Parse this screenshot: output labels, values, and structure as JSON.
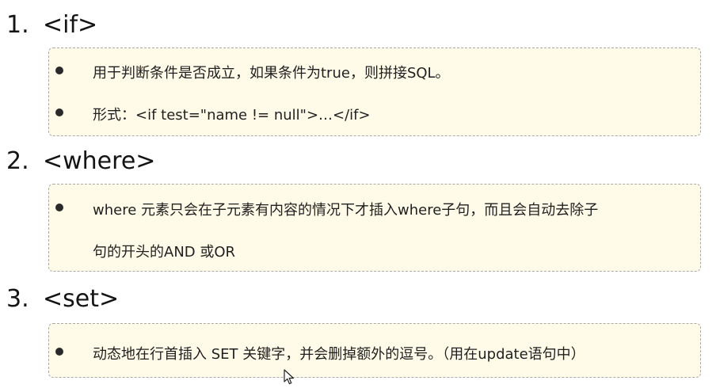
{
  "sections": [
    {
      "number": "1.",
      "title": "<if>",
      "items": [
        "用于判断条件是否成立，如果条件为true，则拼接SQL。",
        "形式：<if test=\"name != null\">…</if>"
      ]
    },
    {
      "number": "2.",
      "title": "<where>",
      "items": [
        "where 元素只会在子元素有内容的情况下才插入where子句，而且会自动去除子",
        "句的开头的AND 或OR"
      ]
    },
    {
      "number": "3.",
      "title": "<set>",
      "items": [
        "动态地在行首插入 SET 关键字，并会删掉额外的逗号。（用在update语句中）"
      ]
    }
  ],
  "colors": {
    "box_background": "#fffbe8",
    "box_border": "#a9a9a9",
    "bullet": "#2a2a2a"
  },
  "icons": {
    "cursor": "mouse-pointer-icon"
  }
}
